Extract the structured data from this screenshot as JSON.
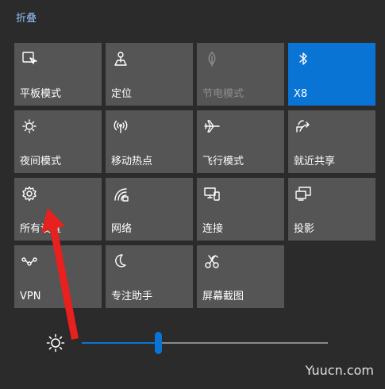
{
  "header": {
    "collapse_label": "折叠"
  },
  "tiles": [
    {
      "label": "平板模式",
      "icon": "tablet-mode-icon",
      "state": "off"
    },
    {
      "label": "定位",
      "icon": "location-icon",
      "state": "off"
    },
    {
      "label": "节电模式",
      "icon": "battery-saver-icon",
      "state": "disabled"
    },
    {
      "label": "X8",
      "icon": "bluetooth-icon",
      "state": "on"
    },
    {
      "label": "夜间模式",
      "icon": "night-light-icon",
      "state": "off"
    },
    {
      "label": "移动热点",
      "icon": "mobile-hotspot-icon",
      "state": "off"
    },
    {
      "label": "飞行模式",
      "icon": "airplane-icon",
      "state": "off"
    },
    {
      "label": "就近共享",
      "icon": "nearby-share-icon",
      "state": "off"
    },
    {
      "label": "所有设置",
      "icon": "gear-icon",
      "state": "off"
    },
    {
      "label": "网络",
      "icon": "network-icon",
      "state": "off"
    },
    {
      "label": "连接",
      "icon": "connect-icon",
      "state": "off"
    },
    {
      "label": "投影",
      "icon": "project-icon",
      "state": "off"
    },
    {
      "label": "VPN",
      "icon": "vpn-icon",
      "state": "off"
    },
    {
      "label": "专注助手",
      "icon": "focus-assist-moon-icon",
      "state": "off"
    },
    {
      "label": "屏幕截图",
      "icon": "screen-snip-icon",
      "state": "off"
    }
  ],
  "brightness": {
    "icon": "sun-icon",
    "level_percent": 31
  },
  "colors": {
    "accent": "#0a74d4",
    "tile": "#555555",
    "background": "#2b2b2b",
    "annotation_arrow": "#e8201e"
  },
  "watermark": {
    "text": "Yuucn.com"
  }
}
